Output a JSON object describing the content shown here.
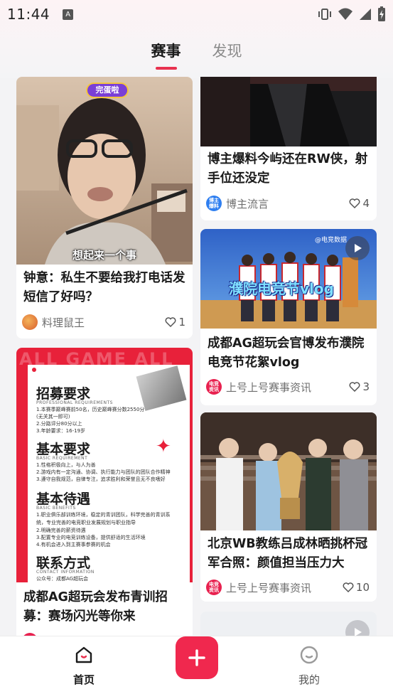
{
  "status": {
    "time": "11:44",
    "a_badge": "A"
  },
  "tabs": [
    {
      "label": "赛事",
      "active": true
    },
    {
      "label": "发现",
      "active": false
    }
  ],
  "cards": {
    "c1": {
      "overlay": "想起来一个事",
      "badge": "完蛋啦",
      "title": "钟意：私生不要给我打电话发短信了好吗？",
      "author": "料理鼠王",
      "likes": "1"
    },
    "c2": {
      "title": "博主爆料今屿还在RW侠，射手位还没定",
      "author": "博主流言",
      "avatar_text": "博主\n爆料",
      "likes": "4"
    },
    "c3": {
      "overlay": "濮院电竞节vlog",
      "watermark": "@电竞数据",
      "title": "成都AG超玩会官博发布濮院电竞节花絮vlog",
      "author": "上号上号赛事资讯",
      "avatar_text": "电竞\n资讯",
      "likes": "3"
    },
    "c4": {
      "poster_bg_text": "ALL GAME ALL",
      "sections": [
        {
          "heading": "招募要求",
          "sub": "PROFESSIONAL REQUIREMENTS",
          "lines": [
            "1.本赛季巅峰赛前50名，历史巅峰赛分数2550分",
            "(无关其一即可)",
            "2.分路评分80分以上",
            "3.年龄要求：16-19岁"
          ]
        },
        {
          "heading": "基本要求",
          "sub": "BASIC REQUIREMENT",
          "lines": [
            "1.性格积极向上，与人为善",
            "2.游戏内有一定沟通、协调、执行能力与团队的团队合作精神",
            "3.遵守自我规范，自律专注，追求胜利和荣誉且无不良嗜好"
          ]
        },
        {
          "heading": "基本待遇",
          "sub": "BASIC BENEFITS",
          "lines": [
            "1.职业俱乐部训练环境，稳定的青训团队，科学完善的青训系统，专业完善的电竞职业发展规划与职业指导",
            "2.明确完善的薪资待遇",
            "3.配置专业的电竞训练设备，提供舒适的生活环境",
            "4.有机会进入到主赛事参赛的机会"
          ]
        },
        {
          "heading": "联系方式",
          "sub": "CONTACT INFORMATION",
          "lines": [
            "公众号：成都AG超玩会"
          ]
        }
      ],
      "title": "成都AG超玩会发布青训招募：赛场闪光等你来"
    },
    "c5": {
      "title": "北京WB教练吕成林晒挑杯冠军合照：颜值担当压力大",
      "author": "上号上号赛事资讯",
      "avatar_text": "电竞\n资讯",
      "likes": "10"
    }
  },
  "bottom_nav": {
    "home": "首页",
    "mine": "我的"
  },
  "colors": {
    "accent": "#e8314f",
    "add_button": "#f0284e",
    "poster_red": "#e8213a"
  },
  "icons": [
    "vibrate-icon",
    "wifi-icon",
    "signal-icon",
    "battery-icon",
    "heart-icon",
    "play-icon",
    "plus-icon",
    "home-icon",
    "profile-icon"
  ]
}
